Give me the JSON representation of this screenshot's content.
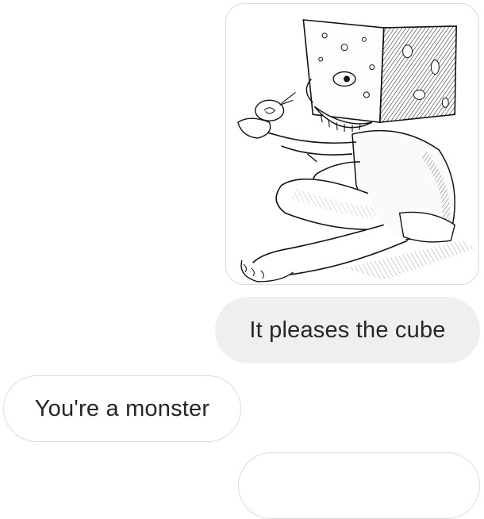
{
  "messages": [
    {
      "type": "image",
      "from": "me",
      "image_alt": "illustration of a cheese-cube-headed figure holding a snail"
    },
    {
      "type": "text",
      "from": "me",
      "text": "It pleases the cube"
    },
    {
      "type": "text",
      "from": "them",
      "text": "You're a monster"
    },
    {
      "type": "text",
      "from": "me",
      "text": ""
    }
  ],
  "colors": {
    "sent_bubble": "#efefef",
    "received_border": "#dbdbdb",
    "text": "#262626"
  }
}
